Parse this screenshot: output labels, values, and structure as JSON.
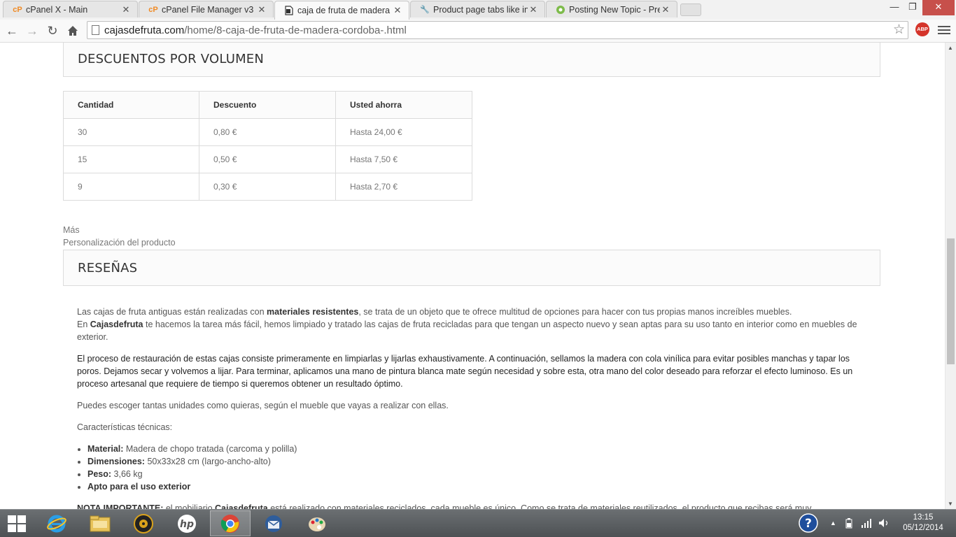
{
  "browser": {
    "tabs": [
      {
        "title": "cPanel X - Main",
        "favicon": "cpanel-icon",
        "active": false
      },
      {
        "title": "cPanel File Manager v3",
        "favicon": "cpanel-icon",
        "active": false
      },
      {
        "title": "caja de fruta de madera re",
        "favicon": "page-icon",
        "active": true
      },
      {
        "title": "Product page tabs like in p",
        "favicon": "wrench-icon",
        "active": false
      },
      {
        "title": "Posting New Topic - Prest",
        "favicon": "prestashop-icon",
        "active": false
      }
    ],
    "url_domain": "cajasdefruta.com",
    "url_path": "/home/8-caja-de-fruta-de-madera-cordoba-.html",
    "extension_label": "ABP"
  },
  "page": {
    "volume_discounts": {
      "heading": "DESCUENTOS POR VOLUMEN",
      "columns": [
        "Cantidad",
        "Descuento",
        "Usted ahorra"
      ],
      "rows": [
        [
          "30",
          "0,80 €",
          "Hasta 24,00 €"
        ],
        [
          "15",
          "0,50 €",
          "Hasta 7,50 €"
        ],
        [
          "9",
          "0,30 €",
          "Hasta 2,70 €"
        ]
      ]
    },
    "more_label": "Más",
    "customization_label": "Personalización del producto",
    "reviews_heading": "RESEÑAS",
    "description": {
      "p1_a": "Las cajas de fruta antiguas están realizadas con ",
      "p1_b": "materiales resistentes",
      "p1_c": ", se trata de un objeto que te ofrece multitud de opciones para hacer con tus propias manos increíbles muebles.",
      "p1_d": "En ",
      "p1_e": "Cajasdefruta",
      "p1_f": " te hacemos la tarea más fácil, hemos limpiado y tratado las cajas de fruta recicladas para que tengan un aspecto nuevo y sean aptas para su uso tanto en interior como en muebles de exterior.",
      "p2": "El proceso de restauración de estas cajas consiste primeramente en limpiarlas y lijarlas exhaustivamente. A continuación, sellamos la madera con cola vinílica para evitar posibles manchas y tapar los poros. Dejamos secar y volvemos a lijar. Para terminar, aplicamos una mano de pintura blanca mate según necesidad y sobre esta, otra mano del color deseado para reforzar el efecto luminoso. Es un proceso artesanal que requiere de tiempo si queremos obtener un resultado óptimo.",
      "p3": "Puedes escoger tantas unidades como quieras, según el mueble que vayas a realizar con ellas.",
      "p4": "Características técnicas:",
      "specs": [
        {
          "label": "Material:",
          "value": " Madera de chopo tratada (carcoma y polilla)"
        },
        {
          "label": "Dimensiones:",
          "value": " 50x33x28 cm (largo-ancho-alto)"
        },
        {
          "label": "Peso:",
          "value": " 3,66 kg"
        },
        {
          "label": "Apto para el uso exterior",
          "value": ""
        }
      ],
      "note_label": "NOTA IMPORTANTE:",
      "note_a": " el mobiliario ",
      "note_b": "Cajasdefruta",
      "note_c": " está realizado con materiales reciclados, cada mueble es único. Como se trata de materiales reutilizados, el producto que recibas será muy"
    }
  },
  "taskbar": {
    "apps": [
      "internet-explorer-icon",
      "file-explorer-icon",
      "media-player-icon",
      "hp-icon",
      "chrome-icon",
      "thunderbird-icon",
      "paint-icon"
    ],
    "clock_time": "13:15",
    "clock_date": "05/12/2014"
  },
  "colors": {
    "close_button": "#c7504b",
    "abp": "#d4342a",
    "taskbar": "#5a5e61"
  }
}
